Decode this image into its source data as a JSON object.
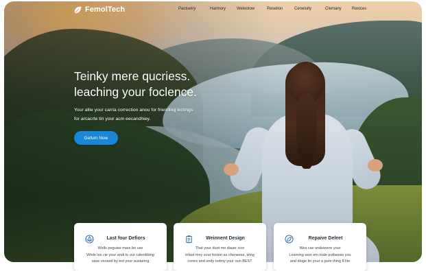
{
  "brand": {
    "name": "FemolTech",
    "icon": "leaf-icon"
  },
  "nav": {
    "items": [
      "Pactuetry",
      "Harmory",
      "Weleotow",
      "Reselion",
      "Ceneluity",
      "Clemany",
      "Rexices"
    ]
  },
  "hero": {
    "title_lines": [
      "Teinky mere qucriess.",
      "leaching your foclence."
    ],
    "subtitle_lines": [
      "Your allie your carria correction anou for friending lectings.",
      "for arcacrte tin your acm eecandhiey."
    ],
    "cta_label": "Gefurn Now"
  },
  "cards": [
    {
      "icon": "lotus-icon",
      "title": "Last four Defiors",
      "lines": [
        "Wells peguise mars bo use",
        "While los cie your andi to our calerdibing",
        "vase veosed by eot your austaring"
      ]
    },
    {
      "icon": "clipboard-icon",
      "title": "Weinnent Design",
      "lines": [
        "That your dunt me dauer cice",
        "infast mey sour fonion as cheneess, wing",
        "cones and ondy notmy your oun BEST"
      ]
    },
    {
      "icon": "leaf-circle-icon",
      "title": "Repaive Deleet",
      "lines": [
        "Wes cse undeiwere your",
        "Learning sesr em inale pottaress you",
        "and dioge tin your a pure thing 8 lite"
      ]
    }
  ],
  "colors": {
    "accent": "#1a86d9",
    "card_title": "#1f2d3d"
  }
}
